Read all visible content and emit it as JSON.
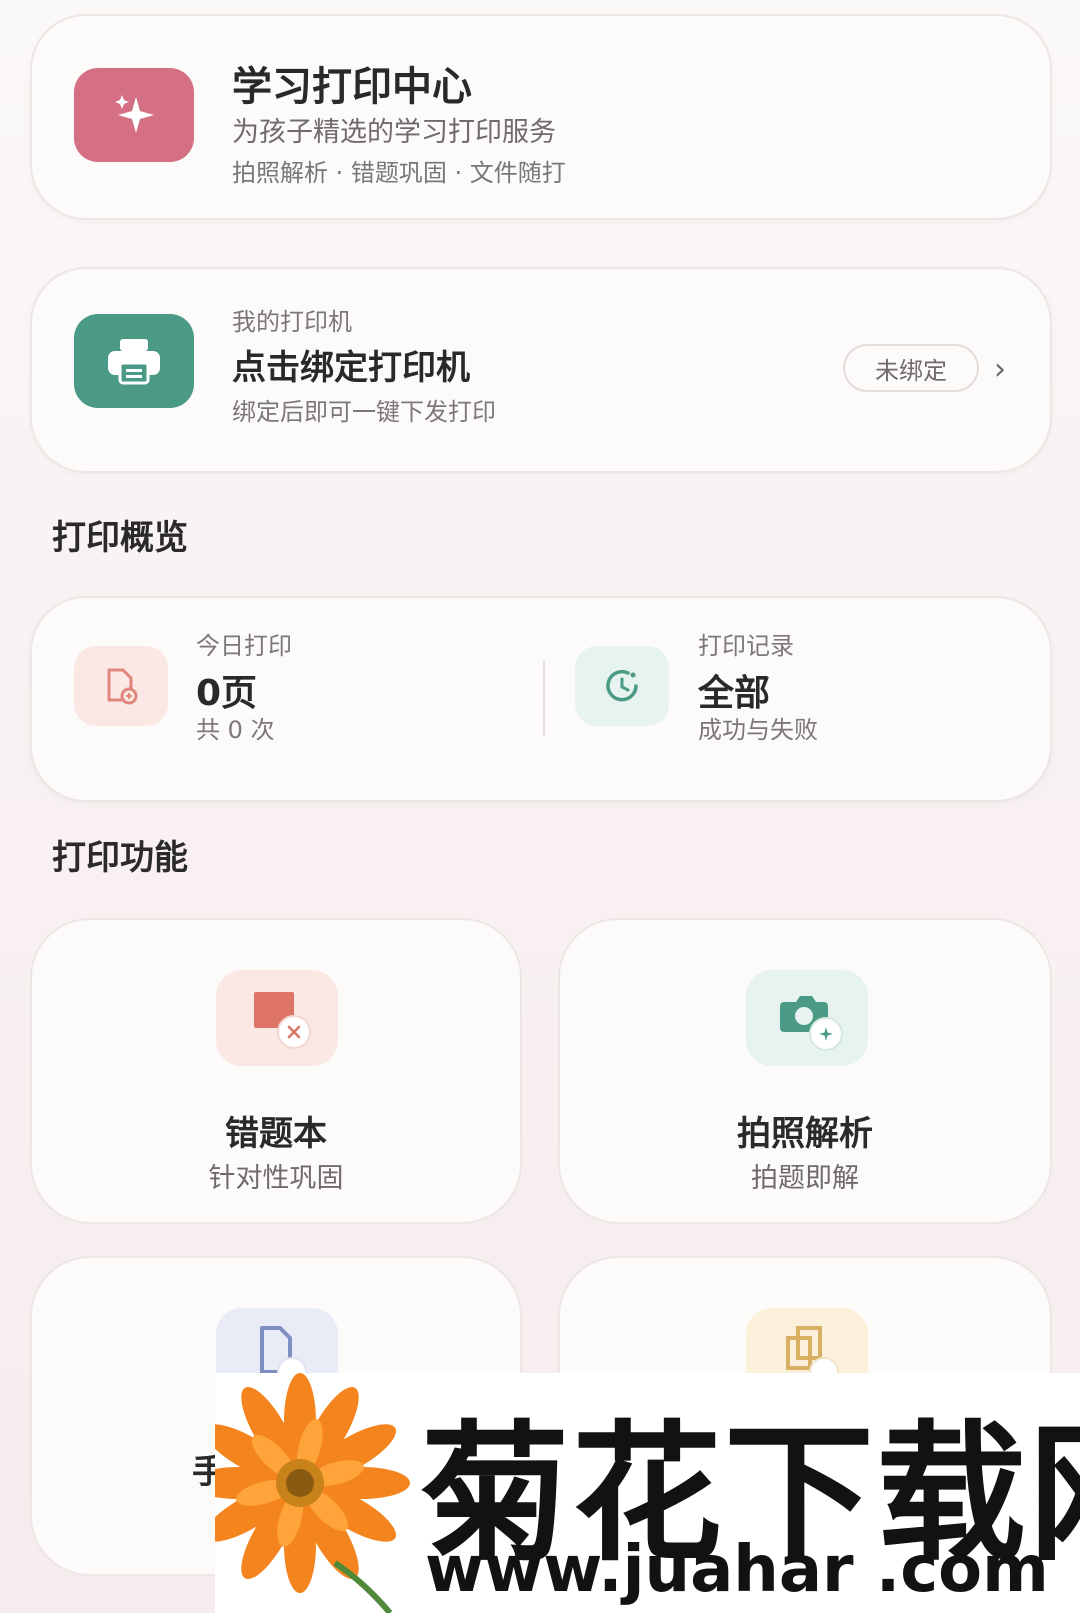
{
  "header": {
    "title": "学习打印中心",
    "subtitle": "为孩子精选的学习打印服务",
    "tags": "拍照解析 · 错题巩固 · 文件随打"
  },
  "printer": {
    "label": "我的打印机",
    "title": "点击绑定打印机",
    "desc": "绑定后即可一键下发打印",
    "status": "未绑定",
    "chevron": "›"
  },
  "overview": {
    "section_title": "打印概览",
    "today": {
      "label": "今日打印",
      "value": "0页",
      "sub": "共 0 次"
    },
    "records": {
      "label": "打印记录",
      "value": "全部",
      "sub": "成功与失败"
    }
  },
  "features": {
    "section_title": "打印功能",
    "items": [
      {
        "title": "错题本",
        "sub": "针对性巩固",
        "icon": "wrong-question-icon"
      },
      {
        "title": "拍照解析",
        "sub": "拍题即解",
        "icon": "camera-icon"
      },
      {
        "title": "手",
        "sub": "",
        "icon": "document-icon"
      },
      {
        "title": "",
        "sub": "",
        "icon": "copy-icon"
      }
    ]
  },
  "watermark": {
    "title": "菊花下载网",
    "url": "www.juahar .com"
  },
  "colors": {
    "accent_pink": "#d46f84",
    "accent_green": "#4b9a86",
    "pink_soft": "#fbe7e4",
    "green_soft": "#e6f3ee"
  }
}
